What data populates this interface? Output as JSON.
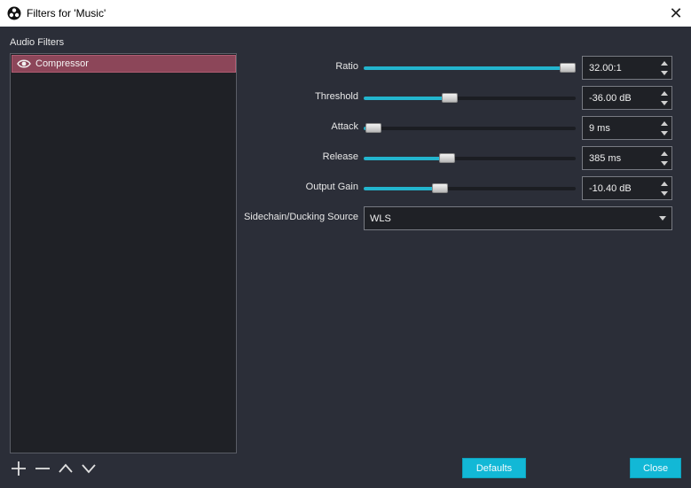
{
  "window": {
    "title": "Filters for 'Music'",
    "close_glyph": "✕"
  },
  "filters_panel": {
    "label": "Audio Filters",
    "items": [
      {
        "name": "Compressor",
        "icon": "eye-icon"
      }
    ],
    "tools": [
      "add-icon",
      "remove-icon",
      "move-up-icon",
      "move-down-icon"
    ]
  },
  "properties": {
    "ratio": {
      "label": "Ratio",
      "value": "32.00:1",
      "level": 1.0
    },
    "threshold": {
      "label": "Threshold",
      "value": "-36.00 dB",
      "level": 0.4
    },
    "attack": {
      "label": "Attack",
      "value": "9 ms",
      "level": 0.01
    },
    "release": {
      "label": "Release",
      "value": "385 ms",
      "level": 0.385
    },
    "output_gain": {
      "label": "Output Gain",
      "value": "-10.40 dB",
      "level": 0.35
    },
    "sidechain": {
      "label": "Sidechain/Ducking Source",
      "value": "WLS"
    }
  },
  "buttons": {
    "defaults": "Defaults",
    "close": "Close"
  },
  "colors": {
    "accent": "#23b5ce",
    "selected_filter": "#8c4659",
    "background": "#2b2e38"
  }
}
